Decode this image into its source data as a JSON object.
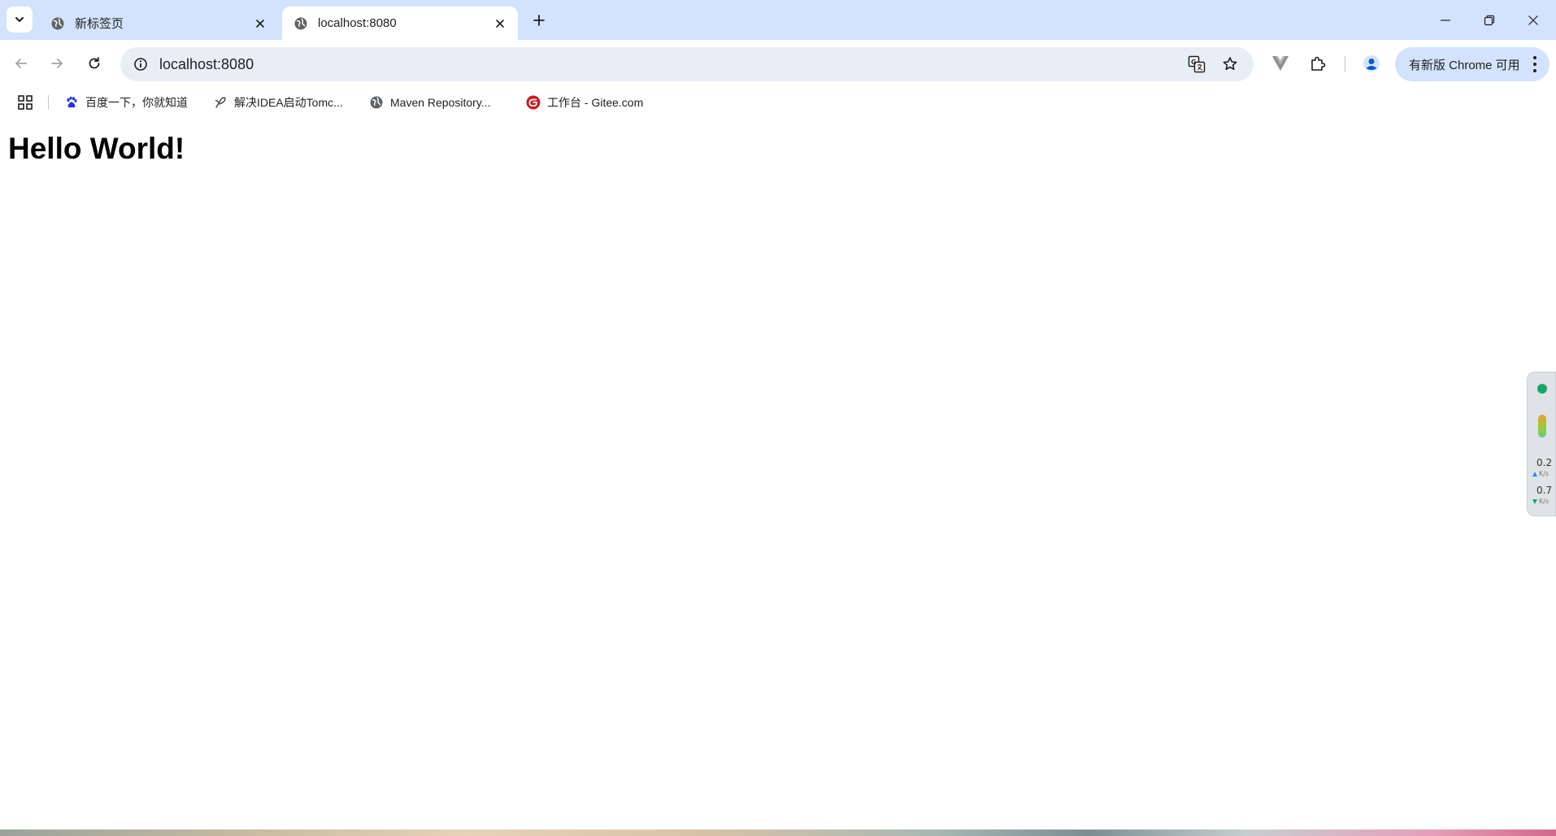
{
  "tabs": [
    {
      "title": "新标签页",
      "active": false
    },
    {
      "title": "localhost:8080",
      "active": true
    }
  ],
  "toolbar": {
    "url": "localhost:8080",
    "update_label": "有新版 Chrome 可用"
  },
  "bookmarks": [
    {
      "label": "百度一下，你就知道",
      "icon": "baidu-paw-icon"
    },
    {
      "label": "解决IDEA启动Tomc...",
      "icon": "feather-icon"
    },
    {
      "label": "Maven Repository...",
      "icon": "globe-icon"
    },
    {
      "label": "工作台 - Gitee.com",
      "icon": "gitee-icon"
    }
  ],
  "page": {
    "heading": "Hello World!"
  },
  "net_widget": {
    "upload": "0.2",
    "upload_unit": "K/s",
    "download": "0.7",
    "download_unit": "K/s"
  },
  "colors": {
    "tabstrip": "#d3e3fd",
    "omnibox": "#e9eef6",
    "update_button": "#d3e3fd"
  }
}
